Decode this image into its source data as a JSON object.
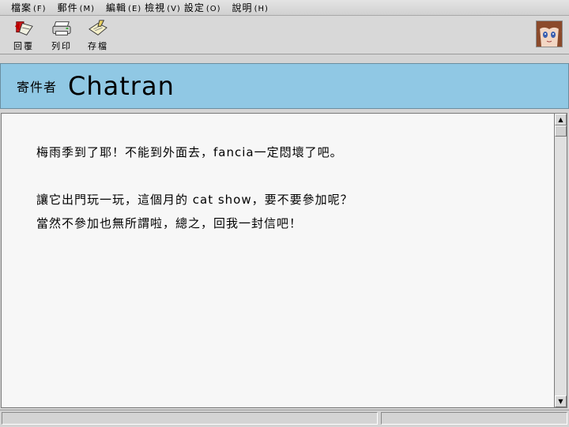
{
  "menu": [
    {
      "label": "檔案",
      "key": "(F)"
    },
    {
      "label": "郵件",
      "key": "(M)"
    },
    {
      "label": "編輯",
      "key": "(E)"
    },
    {
      "label": "檢視",
      "key": "(V)"
    },
    {
      "label": "設定",
      "key": "(O)"
    },
    {
      "label": "說明",
      "key": "(H)"
    }
  ],
  "toolbar": {
    "reply_label": "回覆",
    "print_label": "列印",
    "save_label": "存檔"
  },
  "sender": {
    "label": "寄件者",
    "name": "Chatran"
  },
  "message": {
    "lines": [
      "梅雨季到了耶！不能到外面去，fancia一定悶壞了吧。",
      "讓它出門玩一玩，這個月的 cat show，要不要參加呢？",
      "當然不參加也無所謂啦，總之，回我一封信吧！"
    ]
  },
  "colors": {
    "header_bg": "#90c8e4",
    "body_bg": "#f7f7f7",
    "chrome_bg": "#d4d4d4"
  }
}
